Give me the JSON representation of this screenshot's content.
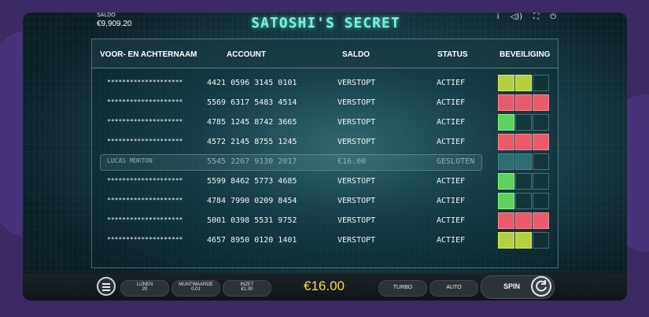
{
  "top": {
    "saldo_label": "SALDO",
    "saldo_value": "€9,909.20",
    "title": "SATOSHI'S SECRET",
    "icons": [
      "info-icon",
      "sound-icon",
      "fullscreen-icon",
      "power-icon"
    ],
    "icon_glyphs": [
      "i",
      "◁))",
      "⛶",
      "⏻"
    ]
  },
  "table": {
    "headers": [
      "VOOR- EN ACHTERNAAM",
      "ACCOUNT",
      "SALDO",
      "STATUS",
      "BEVEILIGING"
    ],
    "rows": [
      {
        "name": "********************",
        "account": "4421 0596 3145 0101",
        "saldo": "VERSTOPT",
        "status": "ACTIEF",
        "security": [
          "yellow-green",
          "yellow-green",
          "empty"
        ]
      },
      {
        "name": "********************",
        "account": "5569 6317 5483 4514",
        "saldo": "VERSTOPT",
        "status": "ACTIEF",
        "security": [
          "red",
          "red",
          "red"
        ]
      },
      {
        "name": "********************",
        "account": "4785 1245 8742 3665",
        "saldo": "VERSTOPT",
        "status": "ACTIEF",
        "security": [
          "green",
          "empty",
          "empty"
        ]
      },
      {
        "name": "********************",
        "account": "4572 2145 8755 1245",
        "saldo": "VERSTOPT",
        "status": "ACTIEF",
        "security": [
          "red",
          "red",
          "red"
        ]
      },
      {
        "name": "LUCAS MORTON",
        "account": "5545 2267 9130 2017",
        "saldo": "€16.00",
        "status": "GESLOTEN",
        "security": [
          "teal",
          "teal",
          "empty"
        ],
        "closed": true
      },
      {
        "name": "********************",
        "account": "5599 8462 5773 4685",
        "saldo": "VERSTOPT",
        "status": "ACTIEF",
        "security": [
          "green",
          "empty",
          "empty"
        ]
      },
      {
        "name": "********************",
        "account": "4784 7990 0209 8454",
        "saldo": "VERSTOPT",
        "status": "ACTIEF",
        "security": [
          "green",
          "empty",
          "empty"
        ]
      },
      {
        "name": "********************",
        "account": "5001 0398 5531 9752",
        "saldo": "VERSTOPT",
        "status": "ACTIEF",
        "security": [
          "red",
          "red",
          "red"
        ]
      },
      {
        "name": "********************",
        "account": "4657 8950 0120 1401",
        "saldo": "VERSTOPT",
        "status": "ACTIEF",
        "security": [
          "yellow-green",
          "yellow-green",
          "empty"
        ]
      }
    ]
  },
  "bottom": {
    "lines_label": "LIJNEN",
    "lines_value": "20",
    "coin_label": "MUNTWAARDE",
    "coin_value": "0.01",
    "bet_label": "INZET",
    "bet_value": "€1.00",
    "total_bet": "€16.00",
    "turbo_label": "TURBO",
    "auto_label": "AUTO",
    "spin_label": "SPIN"
  },
  "colors": {
    "title_glow": "#7ff0d8",
    "bet_amount": "#ffd94a",
    "green": "#5ed25a",
    "yellow_green": "#b4d040",
    "red": "#ea5a6a",
    "teal": "#2e6e72"
  }
}
